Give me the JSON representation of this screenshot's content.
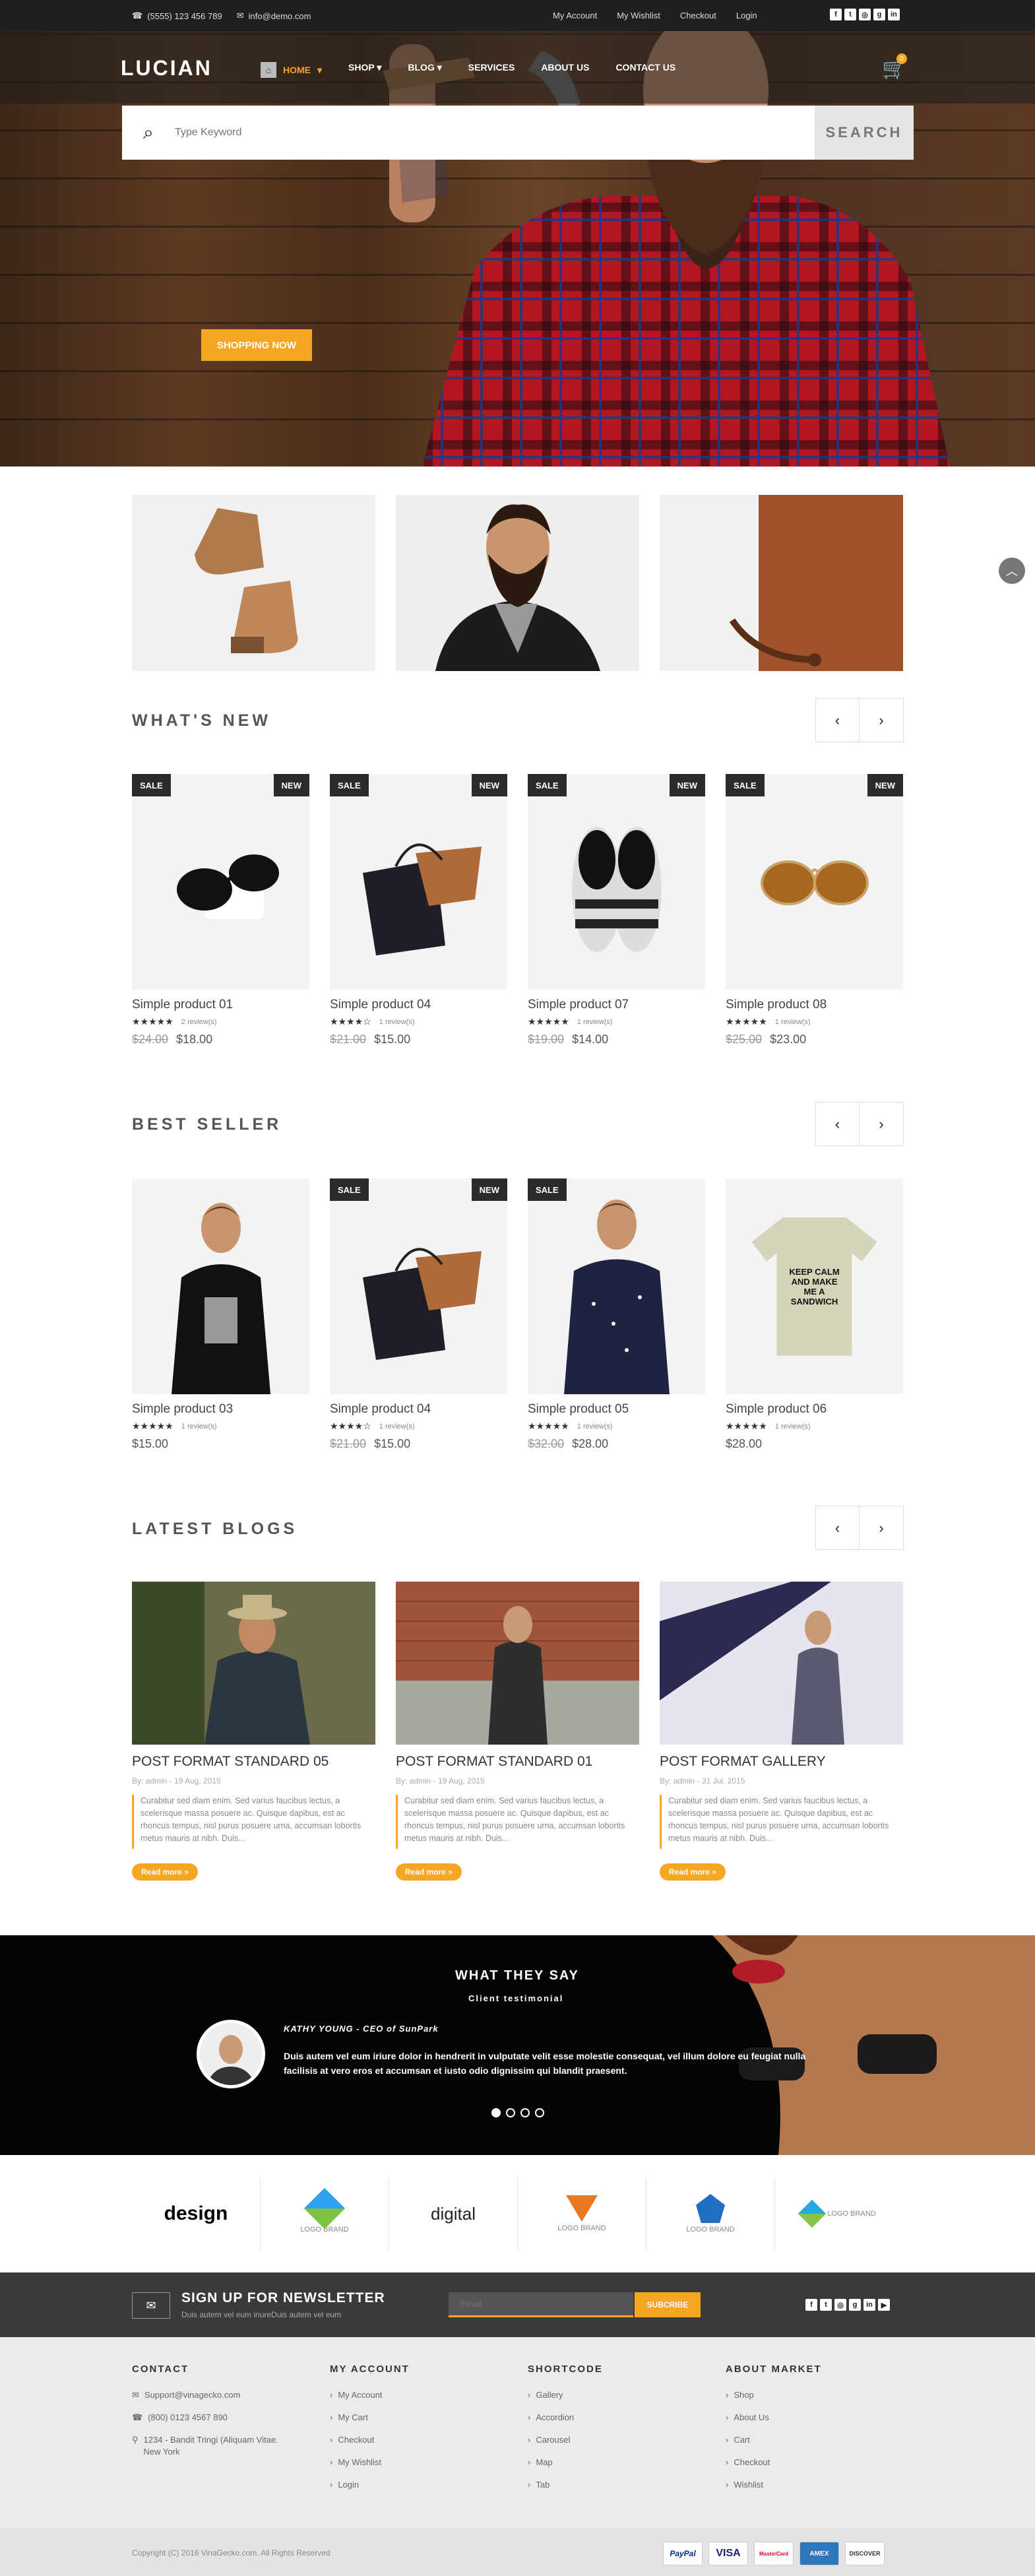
{
  "topbar": {
    "phone": "(5555) 123 456 789",
    "email": "info@demo.com",
    "links": [
      "My Account",
      "My Wishlist",
      "Checkout",
      "Login"
    ],
    "social_icons": [
      "facebook-icon",
      "twitter-icon",
      "instagram-icon",
      "google-plus-icon",
      "linkedin-icon"
    ]
  },
  "header": {
    "logo": "LUCIAN",
    "nav": [
      "HOME",
      "SHOP",
      "BLOG",
      "SERVICES",
      "ABOUT US",
      "CONTACT US"
    ],
    "cart_count": "0",
    "search_placeholder": "Type Keyword",
    "search_button": "SEARCH"
  },
  "hero": {
    "cta": "SHOPPING NOW"
  },
  "sections": {
    "whats_new": "WHAT'S NEW",
    "best_seller": "BEST SELLER",
    "latest_blogs": "LATEST BLOGS"
  },
  "tags": {
    "sale": "SALE",
    "new": "NEW"
  },
  "whats_new": [
    {
      "name": "Simple product 01",
      "reviews": "2 review(s)",
      "old": "$24.00",
      "price": "$18.00",
      "stars": 5
    },
    {
      "name": "Simple product 04",
      "reviews": "1 review(s)",
      "old": "$21.00",
      "price": "$15.00",
      "stars": 4
    },
    {
      "name": "Simple product 07",
      "reviews": "1 review(s)",
      "old": "$19.00",
      "price": "$14.00",
      "stars": 5
    },
    {
      "name": "Simple product 08",
      "reviews": "1 review(s)",
      "old": "$25.00",
      "price": "$23.00",
      "stars": 5
    }
  ],
  "best_seller": [
    {
      "name": "Simple product 03",
      "reviews": "1 review(s)",
      "old": "",
      "price": "$15.00",
      "stars": 5
    },
    {
      "name": "Simple product 04",
      "reviews": "1 review(s)",
      "old": "$21.00",
      "price": "$15.00",
      "stars": 4
    },
    {
      "name": "Simple product 05",
      "reviews": "1 review(s)",
      "old": "$32.00",
      "price": "$28.00",
      "stars": 5
    },
    {
      "name": "Simple product 06",
      "reviews": "1 review(s)",
      "old": "",
      "price": "$28.00",
      "stars": 5
    }
  ],
  "tshirt_text": "KEEP CALM AND MAKE ME A SANDWICH",
  "blogs": [
    {
      "title": "POST FORMAT STANDARD 05",
      "meta": "By: admin - 19 Aug, 2015",
      "excerpt": "Curabitur sed diam enim. Sed varius faucibus lectus, a scelerisque massa posuere ac. Quisque dapibus, est ac rhoncus tempus, nisl purus posuere urna, accumsan lobortis metus mauris at nibh. Duis...",
      "more": "Read more »"
    },
    {
      "title": "POST FORMAT STANDARD 01",
      "meta": "By: admin - 19 Aug, 2015",
      "excerpt": "Curabitur sed diam enim. Sed varius faucibus lectus, a scelerisque massa posuere ac. Quisque dapibus, est ac rhoncus tempus, nisl purus posuere urna, accumsan lobortis metus mauris at nibh. Duis...",
      "more": "Read more »"
    },
    {
      "title": "POST FORMAT GALLERY",
      "meta": "By: admin - 31 Jul, 2015",
      "excerpt": "Curabitur sed diam enim. Sed varius faucibus lectus, a scelerisque massa posuere ac. Quisque dapibus, est ac rhoncus tempus, nisl purus posuere urna, accumsan lobortis metus mauris at nibh. Duis...",
      "more": "Read more »"
    }
  ],
  "testimonial": {
    "title": "WHAT THEY SAY",
    "subtitle": "Client testimonial",
    "author": "KATHY YOUNG - CEO of SunPark",
    "quote": "Duis autem vel eum iriure dolor in hendrerit in vulputate velit esse molestie consequat, vel illum dolore eu feugiat nulla facilisis at vero eros et accumsan et iusto odio dignissim qui blandit praesent."
  },
  "brands": [
    "design",
    "LOGO BRAND",
    "digital",
    "LOGO BRAND",
    "LOGO BRAND",
    "LOGO BRAND"
  ],
  "newsletter": {
    "title": "SIGN UP FOR NEWSLETTER",
    "sub": "Duis autem vel eum iriureDuis autem vel eum",
    "placeholder": "Email",
    "button": "SUBCRIBE"
  },
  "footer": {
    "contact": {
      "title": "CONTACT",
      "email": "Support@vinagecko.com",
      "phone": "(800) 0123 4567 890",
      "address": "1234 - Bandit Tringi (Aliquam Vitae. New York"
    },
    "account": {
      "title": "MY ACCOUNT",
      "items": [
        "My Account",
        "My Cart",
        "Checkout",
        "My Wishlist",
        "Login"
      ]
    },
    "shortcode": {
      "title": "SHORTCODE",
      "items": [
        "Gallery",
        "Accordion",
        "Carousel",
        "Map",
        "Tab"
      ]
    },
    "about": {
      "title": "ABOUT MARKET",
      "items": [
        "Shop",
        "About Us",
        "Cart",
        "Checkout",
        "Wishlist"
      ]
    },
    "copyright": "Copyright (C) 2016 VinaGecko.com. All Rights Reserved",
    "payments": [
      "PayPal",
      "VISA",
      "MasterCard",
      "AMEX",
      "DISCOVER"
    ]
  },
  "colors": {
    "accent": "#f5a623",
    "dark": "#1f1f1f"
  }
}
